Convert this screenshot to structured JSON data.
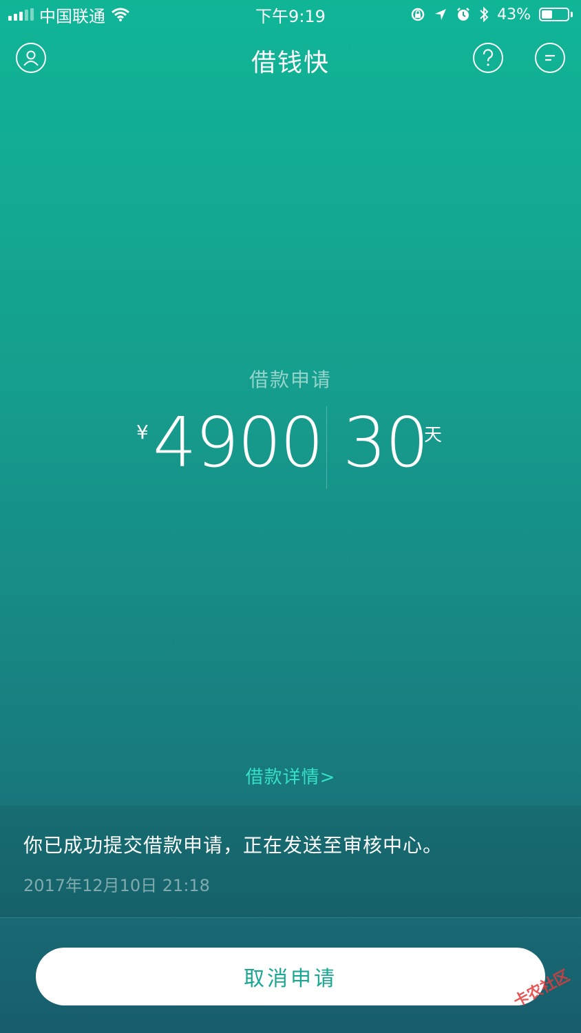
{
  "status_bar": {
    "carrier": "中国联通",
    "time": "下午9:19",
    "battery_percent": "43%",
    "battery_level": 0.43
  },
  "nav": {
    "title": "借钱快",
    "icons": [
      "user-icon",
      "help-icon",
      "message-icon"
    ]
  },
  "loan": {
    "label": "借款申请",
    "currency_symbol": "¥",
    "amount": "4900",
    "days": "30",
    "days_unit": "天",
    "details_link": "借款详情>"
  },
  "message": {
    "text": "你已成功提交借款申请，正在发送至审核中心。",
    "timestamp": "2017年12月10日 21:18"
  },
  "actions": {
    "cancel_label": "取消申请"
  },
  "watermark": {
    "text": "卡农社区"
  },
  "colors": {
    "accent": "#18a892",
    "link": "#35e0c6",
    "gradient_top": "#10b596",
    "gradient_bottom": "#185d6d"
  }
}
